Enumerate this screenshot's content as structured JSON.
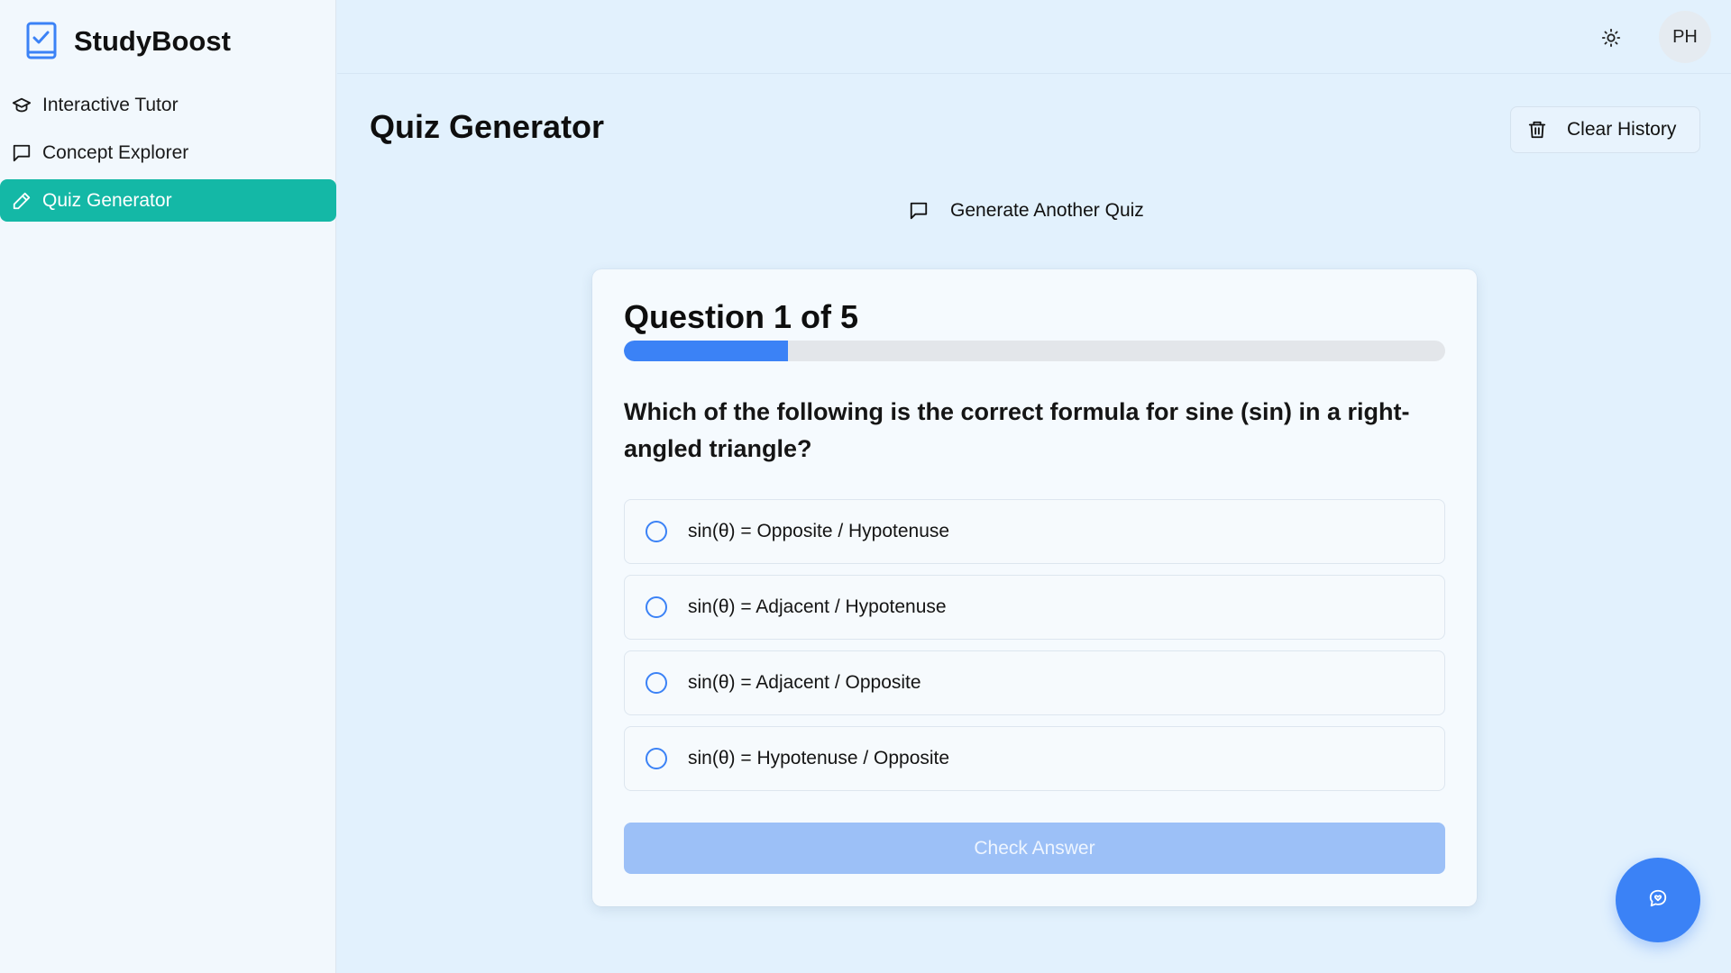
{
  "app": {
    "name": "StudyBoost",
    "logo_icon": "checklist-book-icon"
  },
  "sidebar": {
    "items": [
      {
        "label": "Interactive Tutor",
        "icon": "graduation-cap-icon",
        "active": false
      },
      {
        "label": "Concept Explorer",
        "icon": "chat-bubble-icon",
        "active": false
      },
      {
        "label": "Quiz Generator",
        "icon": "pencil-icon",
        "active": true
      }
    ]
  },
  "topbar": {
    "theme_icon": "sun-icon",
    "avatar_initials": "PH"
  },
  "main": {
    "title": "Quiz Generator",
    "clear_history_label": "Clear History",
    "generate_label": "Generate Another Quiz"
  },
  "quiz": {
    "question_counter": "Question 1 of 5",
    "progress": 0.2,
    "question": "Which of the following is the correct formula for sine (sin) in a right-angled triangle?",
    "options": [
      "sin(θ) = Opposite / Hypotenuse",
      "sin(θ) = Adjacent / Hypotenuse",
      "sin(θ) = Adjacent / Opposite",
      "sin(θ) = Hypotenuse / Opposite"
    ],
    "check_label": "Check Answer"
  },
  "colors": {
    "accent": "#3b82f6",
    "active_nav": "#14b8a6",
    "background": "#e2f1fd"
  },
  "fab": {
    "icon": "chat-heart-icon"
  }
}
